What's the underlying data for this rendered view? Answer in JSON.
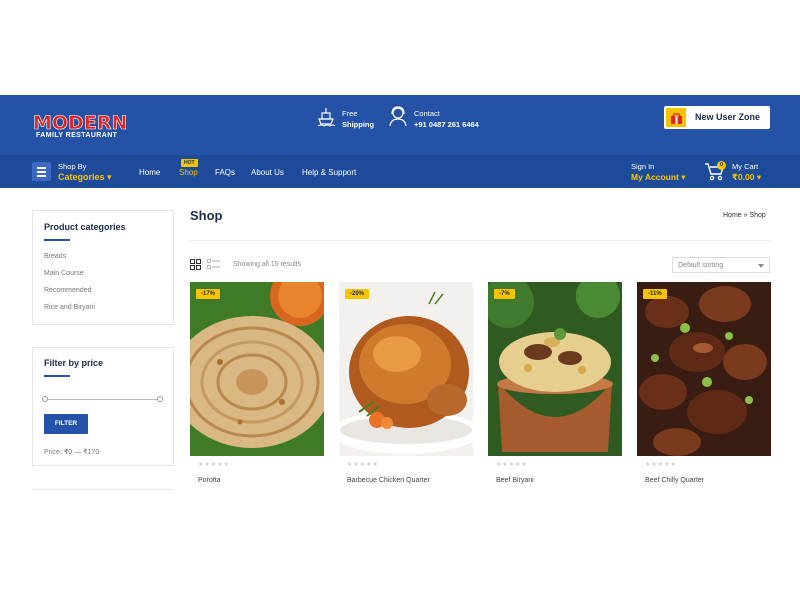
{
  "header": {
    "logo_main": "MODERN",
    "logo_sub": "FAMILY RESTAURANT",
    "shipping": {
      "line1": "Free",
      "line2": "Shipping",
      "icon": "ship-icon"
    },
    "contact": {
      "line1": "Contact",
      "line2": "+91 0487 261 6464",
      "icon": "support-agent-icon"
    },
    "new_user_zone": "New User Zone",
    "colors": {
      "primary": "#2452a6",
      "nav": "#1e4a9a",
      "accent": "#f8c400"
    }
  },
  "nav": {
    "shop_by": "Shop By",
    "categories": "Categories ▾",
    "items": [
      {
        "label": "Home"
      },
      {
        "label": "Shop",
        "badge": "HOT"
      },
      {
        "label": "FAQs"
      },
      {
        "label": "About Us"
      },
      {
        "label": "Help & Support"
      }
    ],
    "sign_in": "Sign In",
    "my_account": "My Account ▾",
    "cart_count": "0",
    "my_cart": "My Cart",
    "cart_total": "₹0.00 ▾"
  },
  "sidebar": {
    "categories_title": "Product categories",
    "categories": [
      "Breads",
      "Main Course",
      "Recommended",
      "Rice and Biryani"
    ],
    "price_title": "Filter by price",
    "filter_label": "FILTER",
    "price_range": "Price: ₹0 — ₹170"
  },
  "main": {
    "title": "Shop",
    "breadcrumb": "Home  » Shop",
    "results": "Showing all 15 results",
    "sort": "Default sorting",
    "stars": "★★★★★",
    "products": [
      {
        "name": "Porotta",
        "sale": "-17%"
      },
      {
        "name": "Barbecue Chicken Quarter",
        "sale": "-20%"
      },
      {
        "name": "Beef Biryani",
        "sale": "-7%"
      },
      {
        "name": "Beef Chilly Quarter",
        "sale": "-11%"
      }
    ]
  }
}
